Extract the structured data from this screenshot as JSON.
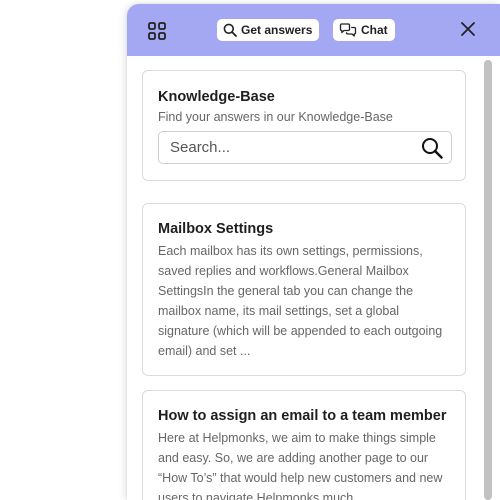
{
  "header": {
    "apps_icon": "grid-icon",
    "get_answers_label": "Get answers",
    "get_answers_icon": "search-icon",
    "chat_label": "Chat",
    "chat_icon": "chat-bubbles-icon",
    "close_icon": "close-icon",
    "background_color": "#a4a8f3"
  },
  "knowledge_base": {
    "title": "Knowledge-Base",
    "subtitle": "Find your answers in our Knowledge-Base",
    "search_placeholder": "Search...",
    "search_value": "",
    "search_icon": "search-icon"
  },
  "articles": [
    {
      "title": "Mailbox Settings",
      "excerpt": "Each mailbox has its own settings, permissions, saved replies and workflows.General Mailbox SettingsIn the general tab you can change the mailbox name, its mail settings, set a global signature (which will be appended to each outgoing email) and set ..."
    },
    {
      "title": "How to assign an email to a team member",
      "excerpt": "Here at Helpmonks, we aim to make things simple and easy. So, we are adding another page to our “How To’s” that would help new customers and new users to navigate Helpmonks much"
    }
  ]
}
